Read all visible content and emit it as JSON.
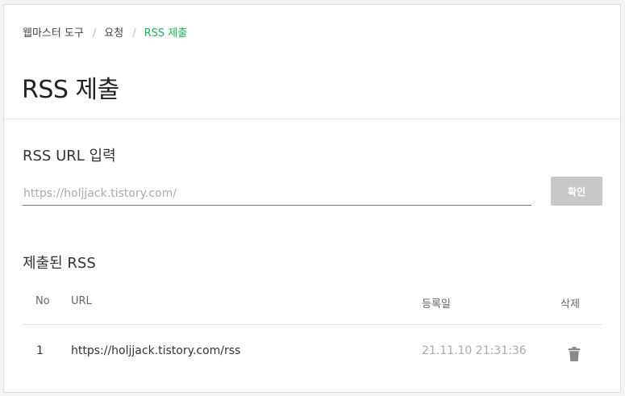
{
  "breadcrumb": {
    "items": [
      "웹마스터 도구",
      "요청",
      "RSS 제출"
    ],
    "separator": "/"
  },
  "page_title": "RSS 제출",
  "url_section": {
    "title": "RSS URL 입력",
    "input_placeholder": "https://holjjack.tistory.com/",
    "input_value": "",
    "confirm_label": "확인"
  },
  "submitted_section": {
    "title": "제출된 RSS",
    "columns": {
      "no": "No",
      "url": "URL",
      "date": "등록일",
      "delete": "삭제"
    },
    "rows": [
      {
        "no": "1",
        "url": "https://holjjack.tistory.com/rss",
        "date": "21.11.10 21:31:36",
        "delete_icon": "trash-icon"
      }
    ]
  },
  "colors": {
    "accent": "#19b35b",
    "button_disabled": "#c8c8c8",
    "muted_text": "#aaaaaa"
  }
}
